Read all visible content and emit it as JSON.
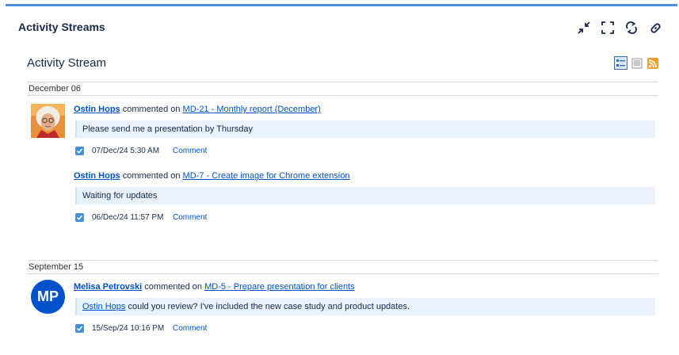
{
  "gadget": {
    "title": "Activity Streams",
    "icons": [
      "minimize-icon",
      "fullscreen-icon",
      "refresh-icon",
      "link-icon"
    ],
    "accent": "#4c8fe0"
  },
  "stream": {
    "title": "Activity Stream",
    "view_icons": [
      "full-view-icon",
      "list-view-icon",
      "rss-icon"
    ]
  },
  "groups": [
    {
      "date": "December 06",
      "entries": [
        {
          "user": "Ostin Hops",
          "action": " commented on ",
          "issue": "MD-21 - Monthly report (December)",
          "comment": "Please send me a presentation by Thursday",
          "timestamp": "07/Dec/24 5:30 AM",
          "comment_link": "Comment"
        },
        {
          "user": "Ostin Hops",
          "action": " commented on ",
          "issue": "MD-7 - Create image for Chrome extension",
          "comment": "Waiting for updates",
          "timestamp": "06/Dec/24 11:57 PM",
          "comment_link": "Comment"
        }
      ]
    },
    {
      "date": "September 15",
      "entries": [
        {
          "user": "Melisa Petrovski",
          "avatar_initials": "MP",
          "action": " commented on ",
          "issue": "MD-5 - Prepare presentation for clients",
          "comment_mention": "Ostin Hops",
          "comment": " could you review? I've included the new case study and product updates.",
          "timestamp": "15/Sep/24 10:16 PM",
          "comment_link": "Comment"
        }
      ]
    }
  ]
}
